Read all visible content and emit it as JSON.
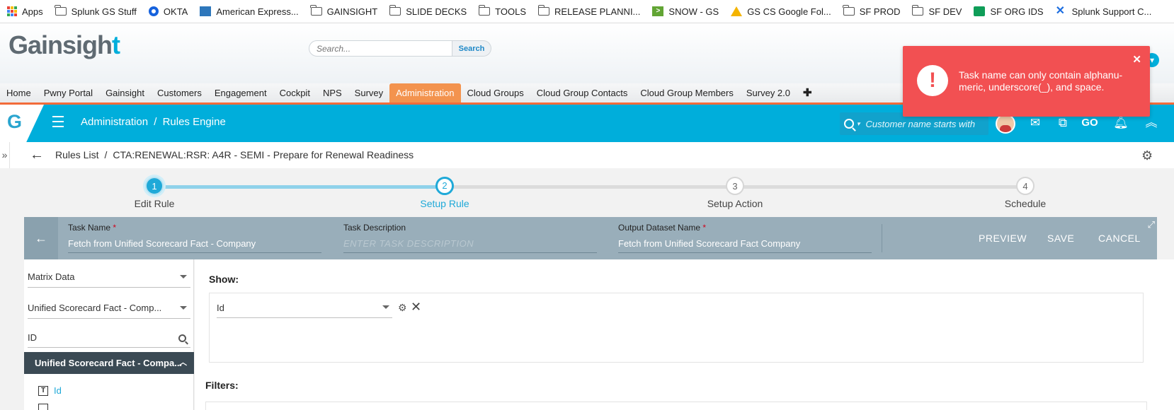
{
  "bookmarks": [
    {
      "label": "Apps",
      "icon": "apps-grid-icon"
    },
    {
      "label": "Splunk GS Stuff",
      "icon": "folder-icon"
    },
    {
      "label": "OKTA",
      "icon": "okta-icon"
    },
    {
      "label": "American Express...",
      "icon": "amex-icon"
    },
    {
      "label": "GAINSIGHT",
      "icon": "folder-icon"
    },
    {
      "label": "SLIDE DECKS",
      "icon": "folder-icon"
    },
    {
      "label": "TOOLS",
      "icon": "folder-icon"
    },
    {
      "label": "RELEASE PLANNI...",
      "icon": "folder-icon"
    },
    {
      "label": "SNOW - GS",
      "icon": "servicenow-icon"
    },
    {
      "label": "GS CS Google Fol...",
      "icon": "google-drive-icon"
    },
    {
      "label": "SF PROD",
      "icon": "folder-icon"
    },
    {
      "label": "SF DEV",
      "icon": "folder-icon"
    },
    {
      "label": "SF ORG IDS",
      "icon": "google-sheets-icon"
    },
    {
      "label": "Splunk Support C...",
      "icon": "confluence-icon"
    }
  ],
  "header": {
    "logo_text_a": "Gainsigh",
    "logo_text_b": "t",
    "search_placeholder": "Search...",
    "search_button": "Search"
  },
  "tabs": [
    {
      "label": "Home"
    },
    {
      "label": "Pwny Portal"
    },
    {
      "label": "Gainsight"
    },
    {
      "label": "Customers"
    },
    {
      "label": "Engagement"
    },
    {
      "label": "Cockpit"
    },
    {
      "label": "NPS"
    },
    {
      "label": "Survey"
    },
    {
      "label": "Administration",
      "active": true
    },
    {
      "label": "Cloud Groups"
    },
    {
      "label": "Cloud Group Contacts"
    },
    {
      "label": "Cloud Group Members"
    },
    {
      "label": "Survey 2.0"
    },
    {
      "label": "✚"
    }
  ],
  "nav": {
    "logo_letter": "G",
    "section": "Administration",
    "separator": "/",
    "page": "Rules Engine",
    "search_placeholder": "Customer name starts with",
    "go_label": "GO"
  },
  "breadcrumb": {
    "root": "Rules List",
    "separator": "/",
    "current": "CTA:RENEWAL:RSR: A4R - SEMI - Prepare for Renewal Readiness"
  },
  "steps": [
    {
      "num": "1",
      "label": "Edit Rule",
      "state": "done"
    },
    {
      "num": "2",
      "label": "Setup Rule",
      "state": "current"
    },
    {
      "num": "3",
      "label": "Setup Action",
      "state": "todo"
    },
    {
      "num": "4",
      "label": "Schedule",
      "state": "todo"
    }
  ],
  "task": {
    "name_label": "Task Name",
    "name_value": "Fetch from Unified Scorecard Fact - Company",
    "description_label": "Task Description",
    "description_placeholder": "ENTER TASK DESCRIPTION",
    "output_label": "Output Dataset Name",
    "output_value": "Fetch from Unified Scorecard Fact  Company",
    "required_mark": "*",
    "preview": "PREVIEW",
    "save": "SAVE",
    "cancel": "CANCEL"
  },
  "left_panel": {
    "source_select": "Matrix Data",
    "object_select": "Unified Scorecard Fact - Comp...",
    "field_search": "ID",
    "group_header": "Unified Scorecard Fact - Compa...",
    "field_item": "Id"
  },
  "show": {
    "label": "Show:",
    "field_value": "Id"
  },
  "filters": {
    "label": "Filters:"
  },
  "toast": {
    "message": "Task name can only contain alphanu-meric, underscore(_), and space."
  },
  "colors": {
    "brand_blue": "#00aedb",
    "active_tab": "#f3934e",
    "toast_red": "#f25052",
    "task_bar": "#99aeba"
  }
}
